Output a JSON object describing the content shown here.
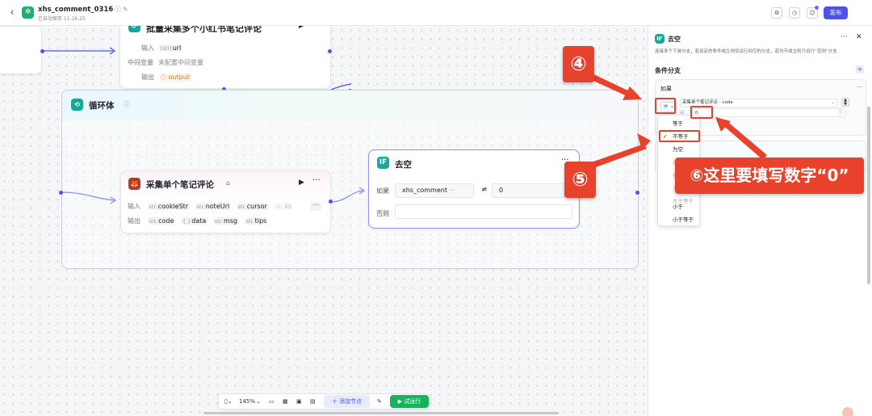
{
  "header": {
    "title": "xhs_comment_0316",
    "saved": "已自动保存 11:26:25",
    "publish_label": "发布"
  },
  "nodes": {
    "batch": {
      "title": "批量采集多个小红书笔记评论",
      "input_label": "输入",
      "input_param": "url",
      "mid_label": "中间变量",
      "mid_value": "未配置中间变量",
      "output_label": "输出",
      "output_param": "output"
    },
    "loop": {
      "title": "循环体"
    },
    "collect": {
      "title": "采集单个笔记评论",
      "input_label": "输入",
      "inputs": [
        {
          "type": "str.",
          "name": "cookieStr"
        },
        {
          "type": "str.",
          "name": "noteUrl"
        },
        {
          "type": "str.",
          "name": "cursor"
        },
        {
          "type": "str.",
          "name": "lis"
        }
      ],
      "output_label": "输出",
      "outputs": [
        {
          "type": "int.",
          "name": "code"
        },
        {
          "type": "{ }",
          "name": "data"
        },
        {
          "type": "str.",
          "name": "msg"
        },
        {
          "type": "str.",
          "name": "tips"
        }
      ]
    },
    "if": {
      "title": "去空",
      "if_label": "如果",
      "left_var": "xhs_comment",
      "operator": "≠",
      "value": "0",
      "else_label": "否则"
    }
  },
  "panel": {
    "title": "去空",
    "description": "连接多个下游分支，若设定的条件成立则仅运行对应的分支，若均不成立则只运行“否则”分支",
    "section": "条件分支",
    "card_label": "如果",
    "operator_chip": "≠",
    "condition_var": "采集单个笔记评论 - code",
    "row2_prefix": "vi",
    "input_value": "n"
  },
  "operator_menu": {
    "items": [
      "等于",
      "不等于",
      "为空",
      "长度大于",
      "长度大于等于",
      "大于",
      "大于等于",
      "小于",
      "小于等于"
    ],
    "selected": "不等于"
  },
  "annotations": {
    "step4": "④",
    "step5": "⑤",
    "step6": "⑥这里要填写数字“0”"
  },
  "toolbar": {
    "zoom": "145%",
    "add_node": "添加节点",
    "run": "试运行"
  },
  "colors": {
    "accent": "#4d53e8",
    "annotation_red": "#e8412c",
    "run_green": "#16b35b",
    "if_teal": "#15a89a"
  }
}
